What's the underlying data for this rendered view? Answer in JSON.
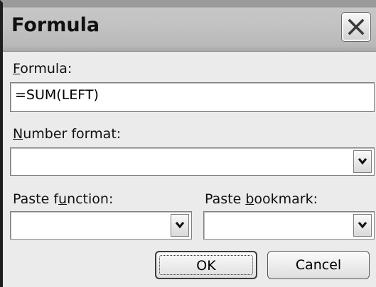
{
  "dialog": {
    "title": "Formula"
  },
  "formula": {
    "label_accel": "F",
    "label_rest": "ormula:",
    "value": "=SUM(LEFT)"
  },
  "number_format": {
    "label_accel": "N",
    "label_rest": "umber format:",
    "value": ""
  },
  "paste_function": {
    "label_pre": "Paste f",
    "label_accel": "u",
    "label_post": "nction:",
    "value": ""
  },
  "paste_bookmark": {
    "label_pre": "Paste ",
    "label_accel": "b",
    "label_post": "ookmark:",
    "value": ""
  },
  "buttons": {
    "ok": "OK",
    "cancel": "Cancel"
  },
  "icons": {
    "close": "close-icon",
    "dropdown": "chevron-down-icon"
  }
}
